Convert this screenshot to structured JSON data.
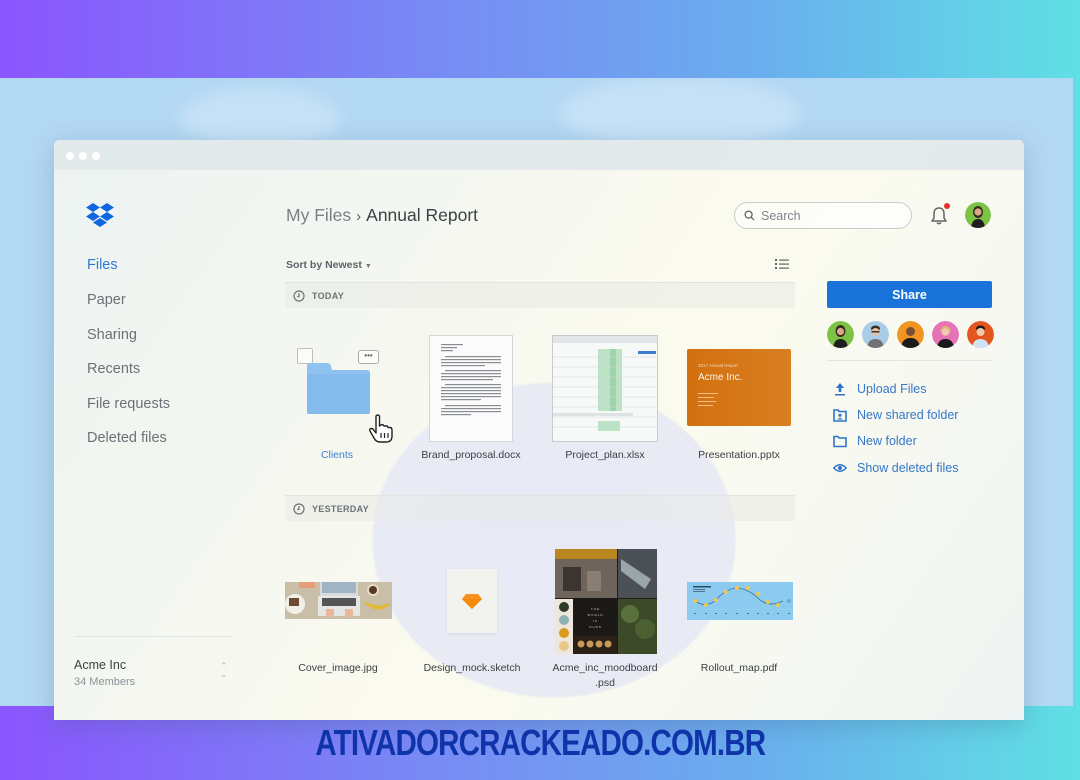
{
  "window": {
    "title_dots": 3
  },
  "sidebar": {
    "logo": "dropbox-logo",
    "items": [
      {
        "label": "Files",
        "active": true
      },
      {
        "label": "Paper",
        "active": false
      },
      {
        "label": "Sharing",
        "active": false
      },
      {
        "label": "Recents",
        "active": false
      },
      {
        "label": "File requests",
        "active": false
      },
      {
        "label": "Deleted files",
        "active": false
      }
    ],
    "team": {
      "name": "Acme Inc",
      "members": "34 Members"
    }
  },
  "header": {
    "breadcrumb": {
      "parent": "My Files",
      "separator": "›",
      "current": "Annual Report"
    },
    "search": {
      "placeholder": "Search",
      "value": ""
    },
    "notifications": {
      "has_unread": true
    }
  },
  "toolbar": {
    "sort_label": "Sort by Newest",
    "view_toggle": "list-view-icon"
  },
  "sections": [
    {
      "label": "TODAY",
      "files": [
        {
          "name": "Clients",
          "type": "folder"
        },
        {
          "name": "Brand_proposal.docx",
          "type": "docx"
        },
        {
          "name": "Project_plan.xlsx",
          "type": "xlsx"
        },
        {
          "name": "Presentation.pptx",
          "type": "pptx",
          "thumb_title_small": "2017 Annual Report",
          "thumb_title": "Acme Inc."
        }
      ]
    },
    {
      "label": "YESTERDAY",
      "files": [
        {
          "name": "Cover_image.jpg",
          "type": "jpg"
        },
        {
          "name": "Design_mock.sketch",
          "type": "sketch"
        },
        {
          "name": "Acme_inc_moodboard .psd",
          "name_line1": "Acme_inc_moodboard",
          "name_line2": ".psd",
          "type": "psd",
          "thumb_text": "THE WORLD IS OURS"
        },
        {
          "name": "Rollout_map.pdf",
          "type": "pdf"
        }
      ]
    }
  ],
  "right_panel": {
    "share_label": "Share",
    "members_count_shown": 5,
    "actions": [
      {
        "label": "Upload Files",
        "icon": "upload-icon"
      },
      {
        "label": "New shared folder",
        "icon": "shared-folder-icon"
      },
      {
        "label": "New folder",
        "icon": "folder-icon"
      },
      {
        "label": "Show deleted files",
        "icon": "eye-icon"
      }
    ]
  },
  "colors": {
    "accent": "#1a73d9",
    "link": "#3577c9",
    "notification_badge": "#e6312e",
    "presentation_orange": "#d2700f"
  },
  "watermark": {
    "text": "ATIVADORCRACKEADO.COM.BR"
  }
}
